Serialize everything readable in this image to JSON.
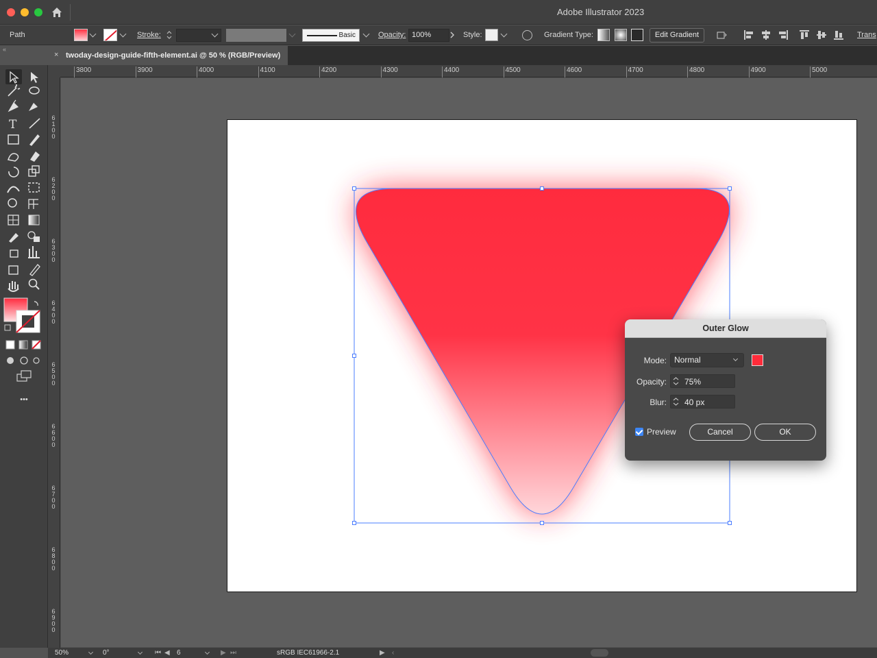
{
  "window": {
    "title": "Adobe Illustrator 2023"
  },
  "control_bar": {
    "selection_type": "Path",
    "stroke_label": "Stroke:",
    "brush_label": "Basic",
    "opacity_label": "Opacity:",
    "opacity_value": "100%",
    "style_label": "Style:",
    "gradient_type_label": "Gradient Type:",
    "edit_gradient_label": "Edit Gradient",
    "transform_label": "Trans"
  },
  "document_tab": {
    "close_glyph": "×",
    "name": "twoday-design-guide-fifth-element.ai @ 50 % (RGB/Preview)"
  },
  "ruler": {
    "top_ticks": [
      "3800",
      "3900",
      "4000",
      "4100",
      "4200",
      "4300",
      "4400",
      "4500",
      "4600",
      "4700",
      "4800",
      "4900",
      "5000"
    ],
    "left_ticks": [
      "6100",
      "6200",
      "6300",
      "6400",
      "6500",
      "6600",
      "6700",
      "6800",
      "6900"
    ]
  },
  "artwork": {
    "shape": "rounded-inverted-triangle",
    "fill_top_color": "#ff2b3e",
    "fill_bottom_color": "#ffd6da",
    "glow_color": "#ff2b3a",
    "selection_color": "#4a7cff"
  },
  "outer_glow_dialog": {
    "title": "Outer Glow",
    "mode_label": "Mode:",
    "mode_value": "Normal",
    "mode_color": "#ff2b3a",
    "opacity_label": "Opacity:",
    "opacity_value": "75%",
    "blur_label": "Blur:",
    "blur_value": "40 px",
    "preview_label": "Preview",
    "preview_checked": true,
    "cancel_label": "Cancel",
    "ok_label": "OK"
  },
  "status_bar": {
    "zoom": "50%",
    "rotation": "0°",
    "artboard_number": "6",
    "color_profile": "sRGB IEC61966-2.1"
  },
  "toolbar": {
    "tools": [
      "selection-tool",
      "direct-selection-tool",
      "magic-wand-tool",
      "lasso-tool",
      "pen-tool",
      "curvature-tool",
      "type-tool",
      "line-segment-tool",
      "rectangle-tool",
      "paintbrush-tool",
      "shaper-tool",
      "eraser-tool",
      "rotate-tool",
      "scale-tool",
      "width-tool",
      "free-transform-tool",
      "shape-builder-tool",
      "perspective-grid-tool",
      "mesh-tool",
      "gradient-tool",
      "eyedropper-tool",
      "blend-tool",
      "symbol-sprayer-tool",
      "column-graph-tool",
      "artboard-tool",
      "slice-tool",
      "hand-tool",
      "zoom-tool"
    ],
    "more_glyph": "•••"
  }
}
